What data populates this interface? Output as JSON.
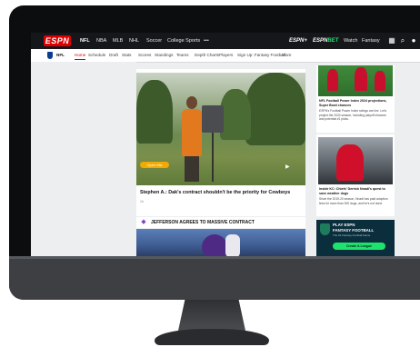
{
  "topnav": {
    "logo": "ESPN",
    "links": [
      "NFL",
      "NBA",
      "MLB",
      "NHL",
      "Soccer",
      "College Sports",
      "•••"
    ],
    "right_logo": "ESPN+",
    "right_logo2_a": "ESPN",
    "right_logo2_b": "BET",
    "watch": "Watch",
    "fantasy": "Fantasy",
    "icons": [
      "grid-icon",
      "search-icon",
      "user-icon"
    ]
  },
  "subnav": {
    "section": "NFL",
    "links": [
      "Home",
      "Schedule",
      "Draft",
      "Stats",
      "Scores",
      "Standings",
      "Teams",
      "Depth Charts",
      "Players",
      "Sign Up: Fantasy Football",
      "More"
    ]
  },
  "main": {
    "badge": "Open Mic",
    "headline": "Stephen A.: Dak's contract shouldn't be the priority for Cowboys",
    "meta": "1h",
    "strip_title": "JEFFERSON AGREES TO MASSIVE CONTRACT"
  },
  "right": {
    "card1_title": "NFL Football Power Index 2024 projections, Super Bowl chances",
    "card1_text": "ESPN's Football Power Index ratings are live. Let's project the 2024 season, including playoff chances and potential #1 picks.",
    "card2_title": "Inside KC: Chiefs' Derrick Nnadi's quest to save weather dogs",
    "card2_text": "Since the 2019-20 season, Nnadi has paid adoption fees for more than 300 dogs, and he's not done.",
    "promo_title": "PLAY ESPN",
    "promo_sub": "FANTASY FOOTBALL",
    "promo_tag": "The #1 Fantasy Football Game",
    "promo_btn": "Create A League"
  },
  "colors": {
    "brand": "#dd0000",
    "bet_green": "#1ee26e",
    "nav_bg": "#16171a"
  }
}
